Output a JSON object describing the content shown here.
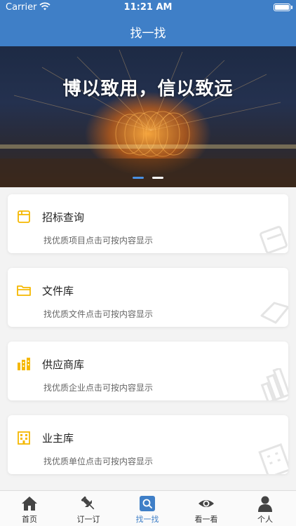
{
  "status": {
    "carrier": "Carrier",
    "time": "11:21 AM"
  },
  "nav": {
    "title": "找一找"
  },
  "banner": {
    "text": "博以致用，信以致远",
    "slides": 2,
    "active_slide": 0
  },
  "cards": [
    {
      "title": "招标查询",
      "subtitle": "找优质项目点击可按内容显示",
      "icon": "tender-icon"
    },
    {
      "title": "文件库",
      "subtitle": "找优质文件点击可按内容显示",
      "icon": "folder-icon"
    },
    {
      "title": "供应商库",
      "subtitle": "找优质企业点击可按内容显示",
      "icon": "buildings-icon"
    },
    {
      "title": "业主库",
      "subtitle": "找优质单位点击可按内容显示",
      "icon": "office-building-icon"
    }
  ],
  "tabs": [
    {
      "label": "首页",
      "icon": "home-icon"
    },
    {
      "label": "订一订",
      "icon": "pin-icon"
    },
    {
      "label": "找一找",
      "icon": "search-icon",
      "active": true
    },
    {
      "label": "看一看",
      "icon": "eye-icon"
    },
    {
      "label": "个人",
      "icon": "person-icon"
    }
  ],
  "colors": {
    "primary": "#3f7fc7",
    "accent": "#f5b800",
    "background": "#f3f3f3"
  }
}
